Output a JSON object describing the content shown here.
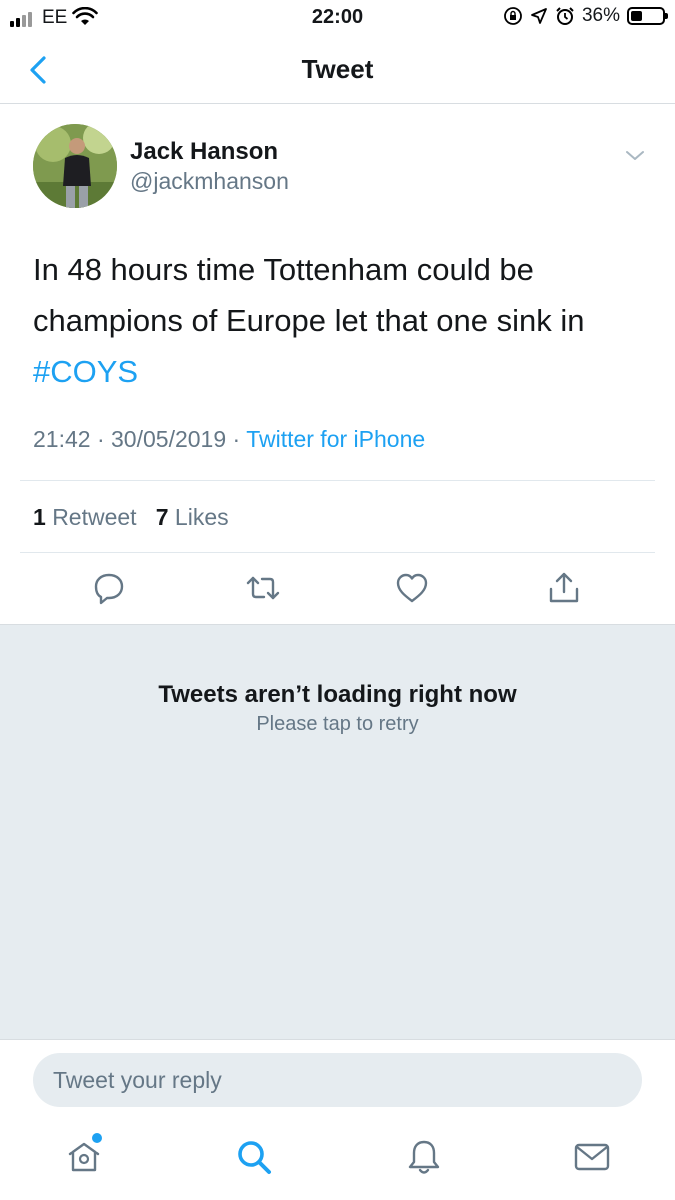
{
  "status_bar": {
    "carrier": "EE",
    "time": "22:00",
    "battery_percent": "36%",
    "battery_level": 0.36,
    "icons": [
      "signal-icon",
      "wifi-icon",
      "rotation-lock-icon",
      "location-icon",
      "alarm-icon",
      "battery-icon"
    ]
  },
  "nav": {
    "title": "Tweet",
    "back_icon": "chevron-left-icon"
  },
  "tweet": {
    "author_name": "Jack Hanson",
    "author_handle": "@jackmhanson",
    "text": "In 48 hours time Tottenham could be champions of Europe let that one sink in",
    "hashtag": "#COYS",
    "time": "21:42",
    "date": "30/05/2019",
    "separator": "·",
    "source": "Twitter for iPhone",
    "retweets_count": "1",
    "retweets_label": "Retweet",
    "likes_count": "7",
    "likes_label": "Likes"
  },
  "actions": [
    "reply-icon",
    "retweet-icon",
    "like-icon",
    "share-icon"
  ],
  "empty_state": {
    "title": "Tweets aren’t loading right now",
    "subtitle": "Please tap to retry"
  },
  "reply": {
    "placeholder": "Tweet your reply"
  },
  "tabs": [
    "home-icon",
    "search-icon",
    "notifications-icon",
    "messages-icon"
  ],
  "colors": {
    "accent": "#1da1f2",
    "secondary_text": "#657786",
    "background_gray": "#e6ecf0"
  }
}
